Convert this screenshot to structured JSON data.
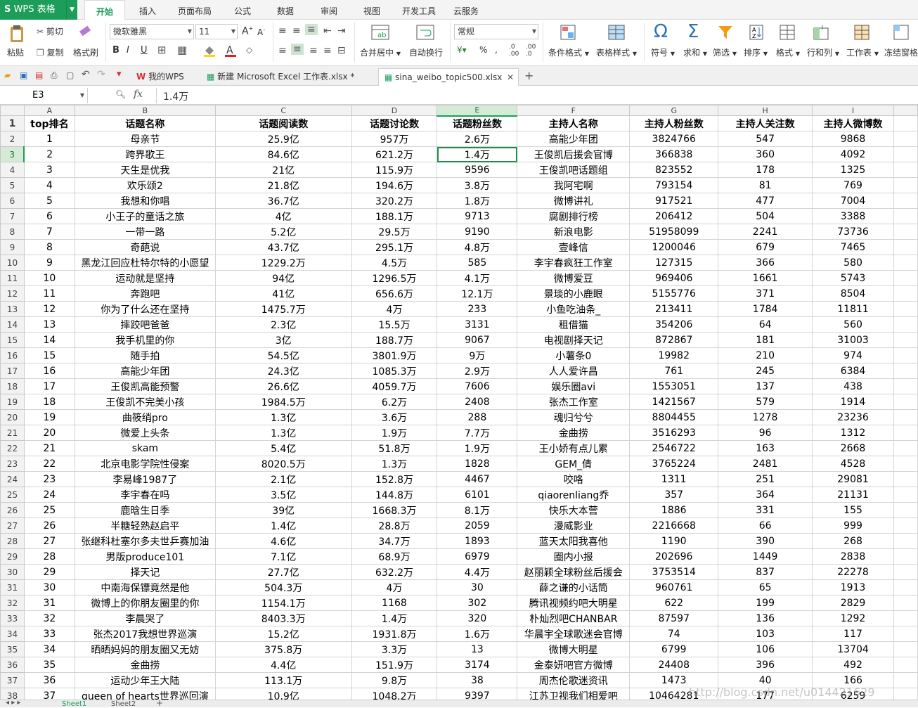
{
  "app": {
    "name": "WPS 表格"
  },
  "menu_tabs": [
    "开始",
    "插入",
    "页面布局",
    "公式",
    "数据",
    "审阅",
    "视图",
    "开发工具",
    "云服务"
  ],
  "ribbon": {
    "paste": "粘贴",
    "cut": "剪切",
    "copy": "复制",
    "format_painter": "格式刷",
    "font_name": "微软雅黑",
    "font_size": "11",
    "merge_center": "合并居中",
    "wrap_text": "自动换行",
    "number_format": "常规",
    "percent": "%",
    "conditional_format": "条件格式",
    "table_style": "表格样式",
    "symbol": "符号",
    "sum": "求和",
    "filter": "筛选",
    "sort": "排序",
    "format": "格式",
    "row_col": "行和列",
    "worksheet": "工作表",
    "freeze": "冻结窗格"
  },
  "doc_tabs": [
    {
      "label": "我的WPS"
    },
    {
      "label": "新建 Microsoft Excel 工作表.xlsx *"
    },
    {
      "label": "sina_weibo_topic500.xlsx"
    }
  ],
  "formula_bar": {
    "cell_ref": "E3",
    "fx": "fx",
    "value": "1.4万"
  },
  "columns": [
    "A",
    "B",
    "C",
    "D",
    "E",
    "F",
    "G",
    "H",
    "I"
  ],
  "header_row": [
    "top排名",
    "话题名称",
    "话题阅读数",
    "话题讨论数",
    "话题粉丝数",
    "主持人名称",
    "主持人粉丝数",
    "主持人关注数",
    "主持人微博数"
  ],
  "rows": [
    [
      "1",
      "母亲节",
      "25.9亿",
      "957万",
      "2.6万",
      "高能少年团",
      "3824766",
      "547",
      "9868"
    ],
    [
      "2",
      "跨界歌王",
      "84.6亿",
      "621.2万",
      "1.4万",
      "王俊凯后援会官博",
      "366838",
      "360",
      "4092"
    ],
    [
      "3",
      "天生是优我",
      "21亿",
      "115.9万",
      "9596",
      "王俊凯吧话题组",
      "823552",
      "178",
      "1325"
    ],
    [
      "4",
      "欢乐颂2",
      "21.8亿",
      "194.6万",
      "3.8万",
      "我阿宅啊",
      "793154",
      "81",
      "769"
    ],
    [
      "5",
      "我想和你唱",
      "36.7亿",
      "320.2万",
      "1.8万",
      "微博讲礼",
      "917521",
      "477",
      "7004"
    ],
    [
      "6",
      "小王子的童话之旅",
      "4亿",
      "188.1万",
      "9713",
      "腐剧排行榜",
      "206412",
      "504",
      "3388"
    ],
    [
      "7",
      "一带一路",
      "5.2亿",
      "29.5万",
      "9190",
      "新浪电影",
      "51958099",
      "2241",
      "73736"
    ],
    [
      "8",
      "奇葩说",
      "43.7亿",
      "295.1万",
      "4.8万",
      "壹峰信",
      "1200046",
      "679",
      "7465"
    ],
    [
      "9",
      "黑龙江回应杜特尔特的小愿望",
      "1229.2万",
      "4.5万",
      "585",
      "李宇春疯狂工作室",
      "127315",
      "366",
      "580"
    ],
    [
      "10",
      "运动就是坚持",
      "94亿",
      "1296.5万",
      "4.1万",
      "微博爱豆",
      "969406",
      "1661",
      "5743"
    ],
    [
      "11",
      "奔跑吧",
      "41亿",
      "656.6万",
      "12.1万",
      "景琰的小鹿眼",
      "5155776",
      "371",
      "8504"
    ],
    [
      "12",
      "你为了什么还在坚持",
      "1475.7万",
      "4万",
      "233",
      "小鱼吃油条_",
      "213411",
      "1784",
      "11811"
    ],
    [
      "13",
      "摔跤吧爸爸",
      "2.3亿",
      "15.5万",
      "3131",
      "租借猫",
      "354206",
      "64",
      "560"
    ],
    [
      "14",
      "我手机里的你",
      "3亿",
      "188.7万",
      "9067",
      "电视剧择天记",
      "872867",
      "181",
      "31003"
    ],
    [
      "15",
      "随手拍",
      "54.5亿",
      "3801.9万",
      "9万",
      "小薯条0",
      "19982",
      "210",
      "974"
    ],
    [
      "16",
      "高能少年团",
      "24.3亿",
      "1085.3万",
      "2.9万",
      "人人爱许昌",
      "761",
      "245",
      "6384"
    ],
    [
      "17",
      "王俊凯高能预警",
      "26.6亿",
      "4059.7万",
      "7606",
      "娱乐圈avi",
      "1553051",
      "137",
      "438"
    ],
    [
      "18",
      "王俊凯不完美小孩",
      "1984.5万",
      "6.2万",
      "2408",
      "张杰工作室",
      "1421567",
      "579",
      "1914"
    ],
    [
      "19",
      "曲筱绡pro",
      "1.3亿",
      "3.6万",
      "288",
      "魂归兮兮",
      "8804455",
      "1278",
      "23236"
    ],
    [
      "20",
      "微爱上头条",
      "1.3亿",
      "1.9万",
      "7.7万",
      "金曲捞",
      "3516293",
      "96",
      "1312"
    ],
    [
      "21",
      "skam",
      "5.4亿",
      "51.8万",
      "1.9万",
      "王小娇有点儿累",
      "2546722",
      "163",
      "2668"
    ],
    [
      "22",
      "北京电影学院性侵案",
      "8020.5万",
      "1.3万",
      "1828",
      "GEM_倩",
      "3765224",
      "2481",
      "4528"
    ],
    [
      "23",
      "李易峰1987了",
      "2.1亿",
      "152.8万",
      "4467",
      "咬咯",
      "1311",
      "251",
      "29081"
    ],
    [
      "24",
      "李宇春在吗",
      "3.5亿",
      "144.8万",
      "6101",
      "qiaorenliang乔",
      "357",
      "364",
      "21131"
    ],
    [
      "25",
      "鹿晗生日季",
      "39亿",
      "1668.3万",
      "8.1万",
      "快乐大本营",
      "1886",
      "331",
      "155"
    ],
    [
      "26",
      "半糖轻熟赵启平",
      "1.4亿",
      "28.8万",
      "2059",
      "漫威影业",
      "2216668",
      "66",
      "999"
    ],
    [
      "27",
      "张继科杜塞尔多夫世乒赛加油",
      "4.6亿",
      "34.7万",
      "1893",
      "蓝天太阳我喜他",
      "1190",
      "390",
      "268"
    ],
    [
      "28",
      "男版produce101",
      "7.1亿",
      "68.9万",
      "6979",
      "圈内小报",
      "202696",
      "1449",
      "2838"
    ],
    [
      "29",
      "择天记",
      "27.7亿",
      "632.2万",
      "4.4万",
      "赵丽颖全球粉丝后援会",
      "3753514",
      "837",
      "22278"
    ],
    [
      "30",
      "中南海保镖竟然是他",
      "504.3万",
      "4万",
      "30",
      "薛之谦的小话筒",
      "960761",
      "65",
      "1913"
    ],
    [
      "31",
      "微博上的你朋友圈里的你",
      "1154.1万",
      "1168",
      "302",
      "腾讯视频约吧大明星",
      "622",
      "199",
      "2829"
    ],
    [
      "32",
      "李晨哭了",
      "8403.3万",
      "1.4万",
      "320",
      "朴灿烈吧CHANBAR",
      "87597",
      "136",
      "1292"
    ],
    [
      "33",
      "张杰2017我想世界巡演",
      "15.2亿",
      "1931.8万",
      "1.6万",
      "华晨宇全球歌迷会官博",
      "74",
      "103",
      "117"
    ],
    [
      "34",
      "晒晒妈妈的朋友圈又无妨",
      "375.8万",
      "3.3万",
      "13",
      "微博大明星",
      "6799",
      "106",
      "13704"
    ],
    [
      "35",
      "金曲捞",
      "4.4亿",
      "151.9万",
      "3174",
      "金泰妍吧官方微博",
      "24408",
      "396",
      "492"
    ],
    [
      "36",
      "运动少年王大陆",
      "113.1万",
      "9.8万",
      "38",
      "周杰伦歌迷资讯",
      "1473",
      "40",
      "166"
    ],
    [
      "37",
      "queen of hearts世界巡回演",
      "10.9亿",
      "1048.2万",
      "9397",
      "江苏卫视我们相爱吧",
      "10464281",
      "177",
      "6259"
    ]
  ],
  "sheet_tabs": [
    "Sheet1",
    "Sheet2"
  ],
  "watermark": "http://blog.csdn.net/u014421629"
}
